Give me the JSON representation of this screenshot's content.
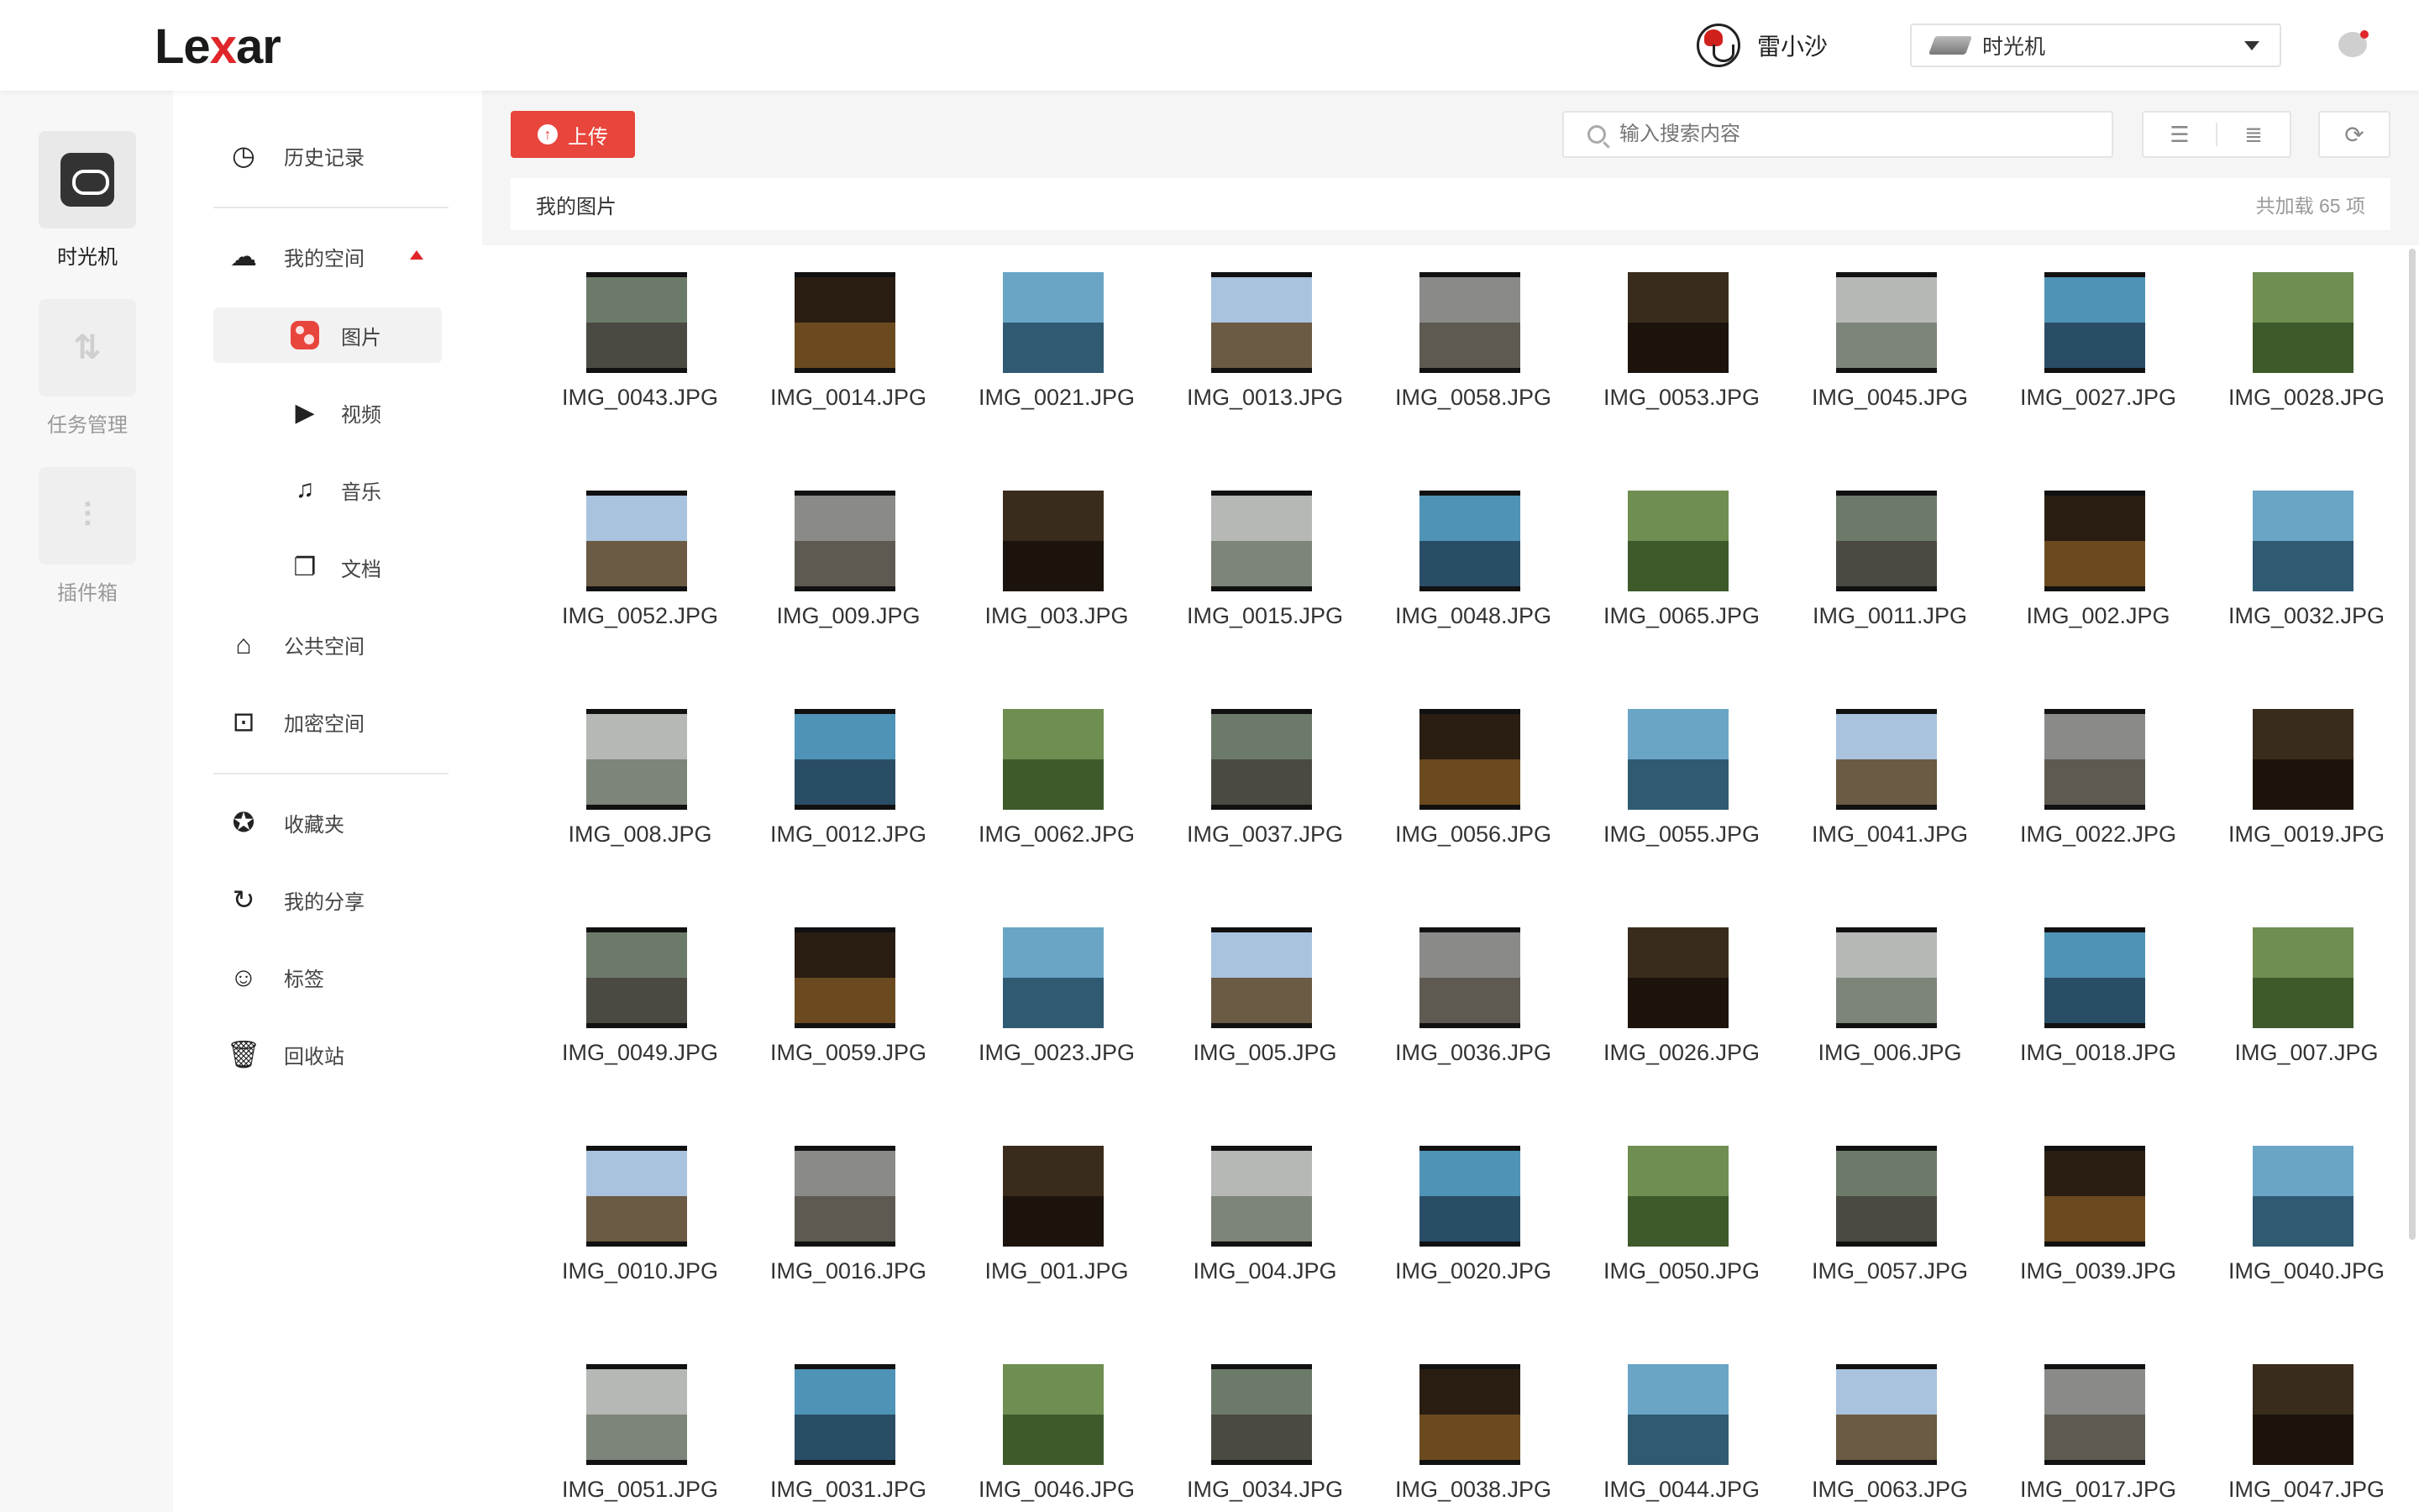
{
  "app": {
    "logo_left": "Le",
    "logo_x": "x",
    "logo_right": "ar"
  },
  "header": {
    "username": "雷小沙",
    "device": "时光机"
  },
  "rail": {
    "items": [
      {
        "label": "时光机",
        "icon": "cloud-drive-icon"
      },
      {
        "label": "任务管理",
        "icon": "transfer-icon"
      },
      {
        "label": "插件箱",
        "icon": "plugin-icon"
      }
    ]
  },
  "nav": {
    "history": "历史记录",
    "my_space": "我的空间",
    "pictures": "图片",
    "videos": "视频",
    "music": "音乐",
    "documents": "文档",
    "public_space": "公共空间",
    "encrypted_space": "加密空间",
    "favorites": "收藏夹",
    "my_shares": "我的分享",
    "tags": "标签",
    "recycle_bin": "回收站"
  },
  "toolbar": {
    "upload_label": "上传",
    "search_placeholder": "输入搜索内容",
    "breadcrumb": "我的图片",
    "count_text": "共加载 65 项"
  },
  "files": [
    "IMG_0043.JPG",
    "IMG_0014.JPG",
    "IMG_0021.JPG",
    "IMG_0013.JPG",
    "IMG_0058.JPG",
    "IMG_0053.JPG",
    "IMG_0045.JPG",
    "IMG_0027.JPG",
    "IMG_0028.JPG",
    "IMG_0052.JPG",
    "IMG_009.JPG",
    "IMG_003.JPG",
    "IMG_0015.JPG",
    "IMG_0048.JPG",
    "IMG_0065.JPG",
    "IMG_0011.JPG",
    "IMG_002.JPG",
    "IMG_0032.JPG",
    "IMG_008.JPG",
    "IMG_0012.JPG",
    "IMG_0062.JPG",
    "IMG_0037.JPG",
    "IMG_0056.JPG",
    "IMG_0055.JPG",
    "IMG_0041.JPG",
    "IMG_0022.JPG",
    "IMG_0019.JPG",
    "IMG_0049.JPG",
    "IMG_0059.JPG",
    "IMG_0023.JPG",
    "IMG_005.JPG",
    "IMG_0036.JPG",
    "IMG_0026.JPG",
    "IMG_006.JPG",
    "IMG_0018.JPG",
    "IMG_007.JPG",
    "IMG_0010.JPG",
    "IMG_0016.JPG",
    "IMG_001.JPG",
    "IMG_004.JPG",
    "IMG_0020.JPG",
    "IMG_0050.JPG",
    "IMG_0057.JPG",
    "IMG_0039.JPG",
    "IMG_0040.JPG",
    "IMG_0051.JPG",
    "IMG_0031.JPG",
    "IMG_0046.JPG",
    "IMG_0034.JPG",
    "IMG_0038.JPG",
    "IMG_0044.JPG",
    "IMG_0063.JPG",
    "IMG_0017.JPG",
    "IMG_0047.JPG"
  ],
  "colors": {
    "accent": "#e8453c",
    "brand_red": "#e0262a"
  }
}
